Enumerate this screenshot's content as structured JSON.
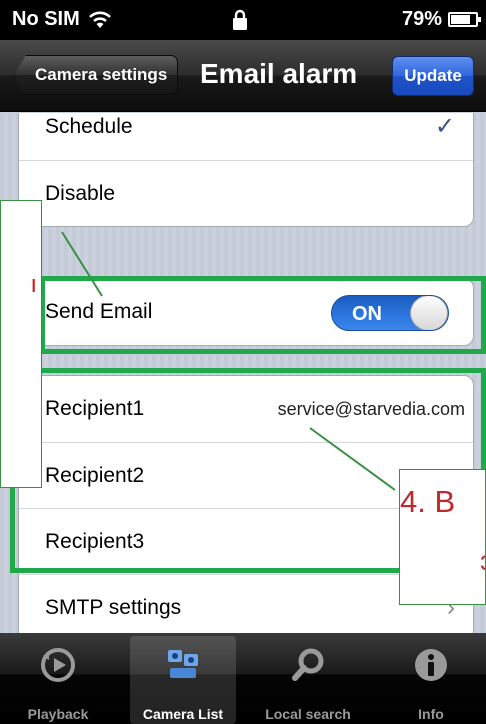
{
  "status_bar": {
    "carrier": "No SIM",
    "battery": "79%",
    "battery_level": 0.79
  },
  "nav": {
    "back_label": "Camera settings",
    "title": "Email alarm",
    "update_label": "Update"
  },
  "mode_group": [
    {
      "label": "Schedule",
      "checked": true
    },
    {
      "label": "Disable",
      "checked": false
    }
  ],
  "send_email": {
    "label": "Send Email",
    "toggle": "ON"
  },
  "recipients": [
    {
      "label": "Recipient1",
      "value": "service@starvedia.com"
    },
    {
      "label": "Recipient2",
      "value": ""
    },
    {
      "label": "Recipient3",
      "value": ""
    },
    {
      "label": "SMTP settings",
      "value": ""
    }
  ],
  "annotations": {
    "left_glyph": "ı",
    "step_text": "4. В",
    "step_text_line2": "э"
  },
  "tab_bar": [
    {
      "label": "Playback",
      "icon": "playback-icon"
    },
    {
      "label": "Camera List",
      "icon": "camera-list-icon",
      "active": true
    },
    {
      "label": "Local search",
      "icon": "search-icon"
    },
    {
      "label": "Info",
      "icon": "info-icon"
    }
  ]
}
